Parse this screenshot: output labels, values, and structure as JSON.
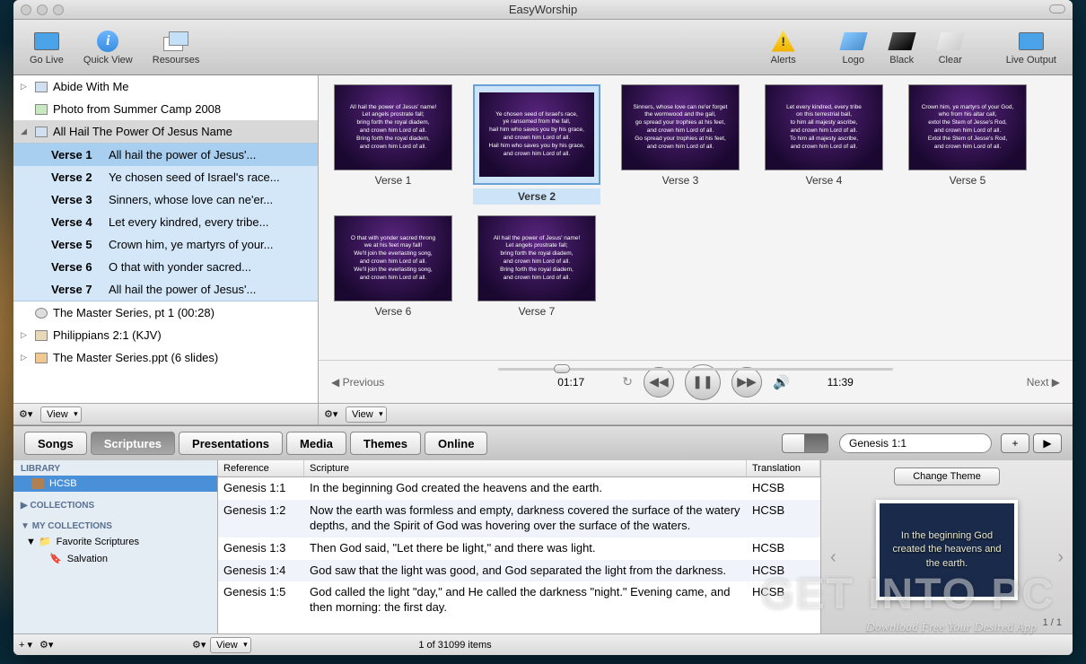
{
  "window": {
    "title": "EasyWorship"
  },
  "toolbar": {
    "go_live": "Go Live",
    "quick_view": "Quick View",
    "resources": "Resourses",
    "alerts": "Alerts",
    "logo": "Logo",
    "black": "Black",
    "clear": "Clear",
    "live_output": "Live Output"
  },
  "schedule": {
    "items": [
      {
        "title": "Abide With Me",
        "type": "song"
      },
      {
        "title": "Photo from Summer Camp 2008",
        "type": "image"
      },
      {
        "title": "All Hail The Power Of Jesus Name",
        "type": "song",
        "expanded": true
      },
      {
        "title": "The Master Series, pt 1  (00:28)",
        "type": "media"
      },
      {
        "title": "Philippians 2:1  (KJV)",
        "type": "scripture"
      },
      {
        "title": "The Master Series.ppt   (6 slides)",
        "type": "presentation"
      }
    ],
    "verses": [
      {
        "num": "Verse 1",
        "text": "All hail the power of Jesus'...",
        "selected": true
      },
      {
        "num": "Verse 2",
        "text": "Ye chosen seed of Israel's race..."
      },
      {
        "num": "Verse 3",
        "text": "Sinners, whose love can ne'er..."
      },
      {
        "num": "Verse 4",
        "text": "Let every kindred, every tribe..."
      },
      {
        "num": "Verse 5",
        "text": "Crown him, ye martyrs of your..."
      },
      {
        "num": "Verse 6",
        "text": "O that with yonder sacred..."
      },
      {
        "num": "Verse 7",
        "text": "All hail the power of Jesus'..."
      }
    ],
    "footer_view": "View"
  },
  "slides": [
    {
      "label": "Verse 1",
      "lines": "All hail the power of Jesus' name!\nLet angels prostrate fall;\nbring forth the royal diadem,\nand crown him Lord of all.\nBring forth the royal diadem,\nand crown him Lord of all."
    },
    {
      "label": "Verse 2",
      "selected": true,
      "lines": "Ye chosen seed of Israel's race,\nye ransomed from the fall,\nhail him who saves you by his grace,\nand crown him Lord of all.\nHail him who saves you by his grace,\nand crown him Lord of all."
    },
    {
      "label": "Verse 3",
      "lines": "Sinners, whose love can ne'er forget\nthe wormwood and the gall,\ngo spread your trophies at his feet,\nand crown him Lord of all.\nGo spread your trophies at his feet,\nand crown him Lord of all."
    },
    {
      "label": "Verse 4",
      "lines": "Let every kindred, every tribe\non this terrestrial ball,\nto him all majesty ascribe,\nand crown him Lord of all.\nTo him all majesty ascribe,\nand crown him Lord of all."
    },
    {
      "label": "Verse 5",
      "lines": "Crown him, ye martyrs of your God,\nwho from his altar call,\nextol the Stem of Jesse's Rod,\nand crown him Lord of all.\nExtol the Stem of Jesse's Rod,\nand crown him Lord of all."
    },
    {
      "label": "Verse 6",
      "lines": "O that with yonder sacred throng\nwe at his feet may fall!\nWe'll join the everlasting song,\nand crown him Lord of all.\nWe'll join the everlasting song,\nand crown him Lord of all."
    },
    {
      "label": "Verse 7",
      "lines": "All hail the power of Jesus' name!\nLet angels prostrate fall;\nbring forth the royal diadem,\nand crown him Lord of all.\nBring forth the royal diadem,\nand crown him Lord of all."
    }
  ],
  "transport": {
    "previous": "Previous",
    "next": "Next",
    "elapsed": "01:17",
    "total": "11:39"
  },
  "preview_footer_view": "View",
  "library": {
    "tabs": [
      "Songs",
      "Scriptures",
      "Presentations",
      "Media",
      "Themes",
      "Online"
    ],
    "active_tab": "Scriptures",
    "search_value": "Genesis 1:1",
    "add_btn": "+",
    "play_btn": "▶",
    "nav": {
      "library_hdr": "LIBRARY",
      "library_items": [
        {
          "label": "HCSB",
          "selected": true
        }
      ],
      "collections_hdr": "COLLECTIONS",
      "my_collections_hdr": "MY COLLECTIONS",
      "my_collections": [
        {
          "label": "Favorite Scriptures"
        },
        {
          "label": "Salvation"
        }
      ]
    },
    "columns": {
      "ref": "Reference",
      "scr": "Scripture",
      "tr": "Translation"
    },
    "rows": [
      {
        "ref": "Genesis 1:1",
        "scr": "In the beginning God created the heavens and the earth.",
        "tr": "HCSB"
      },
      {
        "ref": "Genesis 1:2",
        "scr": "Now the earth was formless and empty, darkness covered the surface of the watery depths, and the Spirit of God was hovering over the surface of the waters.",
        "tr": "HCSB"
      },
      {
        "ref": "Genesis 1:3",
        "scr": "Then God said, \"Let there be light,\" and there was light.",
        "tr": "HCSB"
      },
      {
        "ref": "Genesis 1:4",
        "scr": "God saw that the light was good, and God separated the light from the darkness.",
        "tr": "HCSB"
      },
      {
        "ref": "Genesis 1:5",
        "scr": "God called the light \"day,\" and He called the darkness \"night.\" Evening came, and then morning: the first day.",
        "tr": "HCSB"
      }
    ],
    "preview": {
      "change_theme": "Change Theme",
      "text": "In the beginning God created the heavens and the earth.",
      "page": "1 / 1"
    },
    "footer_status": "1 of 31099 items",
    "footer_view": "View"
  },
  "watermark": {
    "main": "GET INTO PC",
    "sub": "Download Free Your Desired App"
  }
}
